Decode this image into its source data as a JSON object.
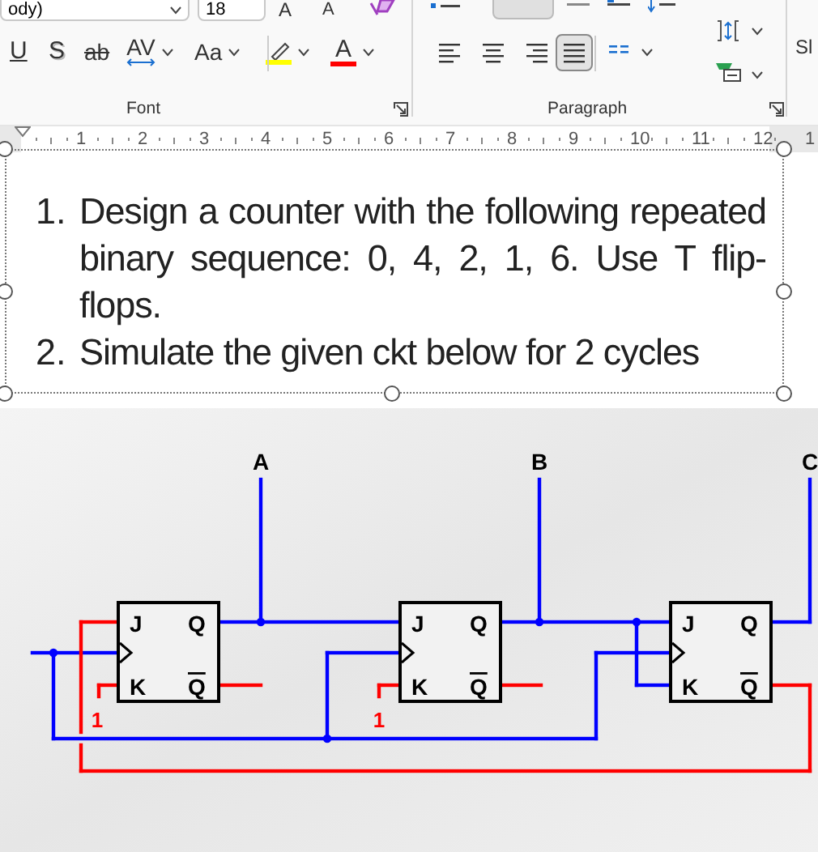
{
  "ribbon": {
    "font_name": "ody)",
    "font_size": "18",
    "grow_label": "A",
    "shrink_label": "A",
    "format_buttons": [
      {
        "kind": "underline",
        "label": "U"
      },
      {
        "kind": "shadow",
        "label": "S"
      },
      {
        "kind": "strike",
        "label": "ab"
      },
      {
        "kind": "spacing",
        "label": "AV"
      },
      {
        "kind": "case",
        "label": "Aa"
      },
      {
        "kind": "highlight",
        "color": "#ffff00"
      },
      {
        "kind": "fontcolor",
        "label": "A",
        "color": "#ff0000"
      }
    ],
    "align_buttons": [
      {
        "kind": "left",
        "selected": false
      },
      {
        "kind": "center",
        "selected": false
      },
      {
        "kind": "right",
        "selected": false
      },
      {
        "kind": "justify",
        "selected": true
      }
    ],
    "groups": [
      "Font",
      "Paragraph"
    ],
    "cut_label": "Sl"
  },
  "ruler_numbers": [
    "1",
    "2",
    "3",
    "4",
    "5",
    "6",
    "7",
    "8",
    "9",
    "10",
    "11",
    "12",
    "1"
  ],
  "list": [
    {
      "number": "1.",
      "text": "Design a counter with the following repeated binary sequence: 0, 4, 2, 1, 6. Use T flip-flops."
    },
    {
      "number": "2.",
      "text": "Simulate the given ckt below for 2 cycles"
    }
  ],
  "circuit": {
    "outputs": [
      "A",
      "B",
      "C"
    ],
    "flip_flops": [
      {
        "j": "J",
        "k": "K",
        "q": "Q",
        "q_bar": "Q"
      },
      {
        "j": "J",
        "k": "K",
        "q": "Q",
        "q_bar": "Q"
      },
      {
        "j": "J",
        "k": "K",
        "q": "Q",
        "q_bar": "Q"
      }
    ],
    "constants": [
      "1",
      "1"
    ]
  }
}
